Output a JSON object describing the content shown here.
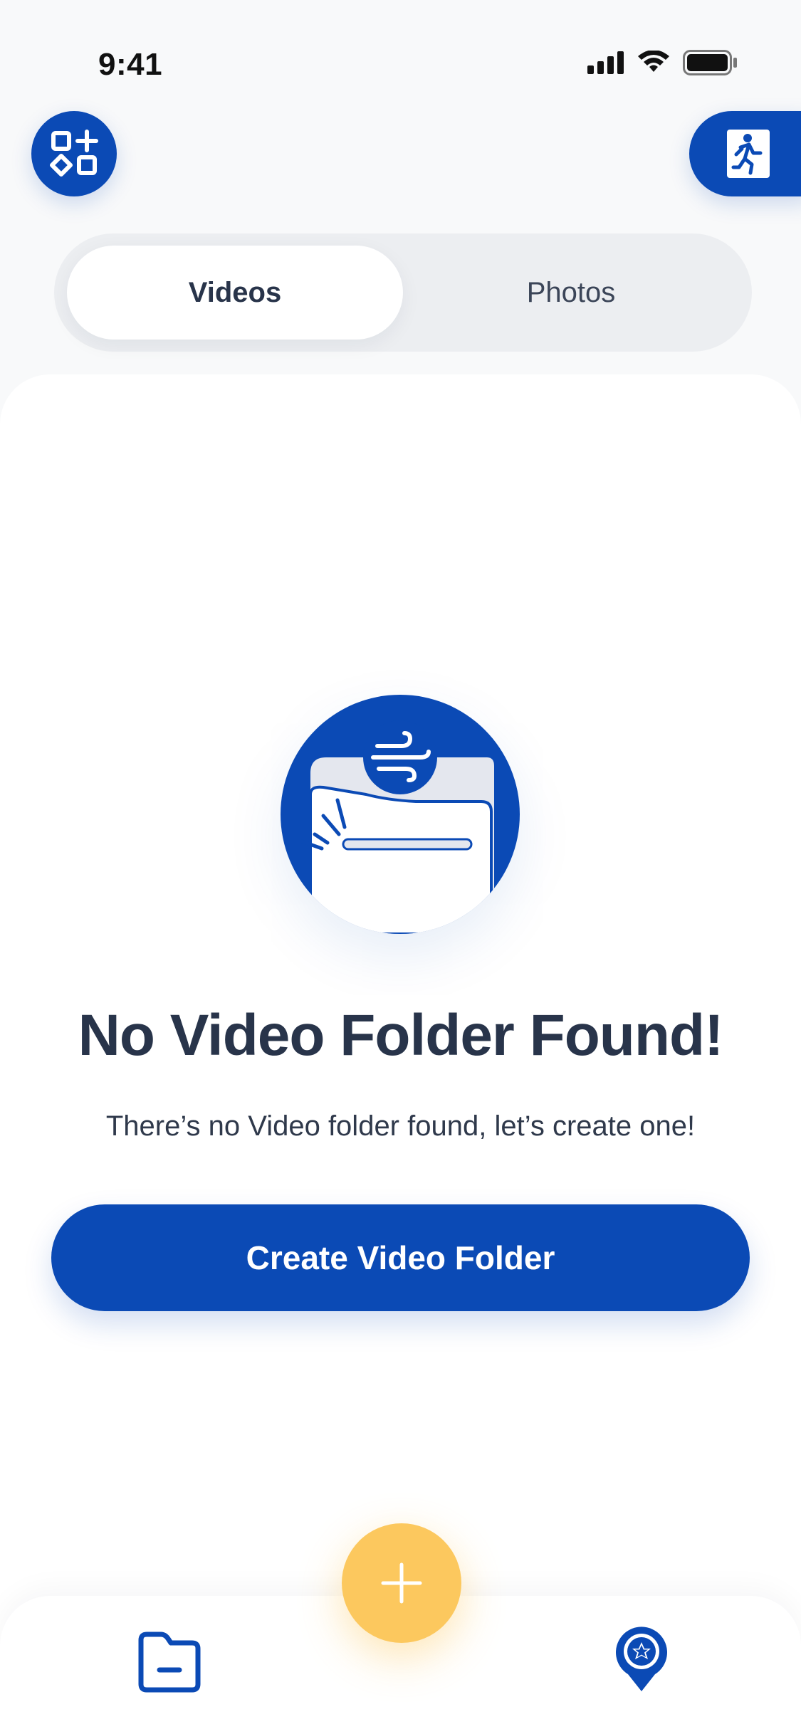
{
  "status_bar": {
    "time": "9:41"
  },
  "header": {
    "widgets_icon": "widgets-icon",
    "exit_icon": "exit-running-man-icon"
  },
  "tabs": [
    {
      "label": "Videos",
      "active": true
    },
    {
      "label": "Photos",
      "active": false
    }
  ],
  "empty_state": {
    "illustration": "empty-folder-wind-icon",
    "title": "No Video Folder Found!",
    "message": "There’s no Video folder found, let’s create one!",
    "button_label": "Create Video Folder"
  },
  "bottom_nav": {
    "left_icon": "folder-icon",
    "fab_icon": "plus-icon",
    "right_icon": "badge-location-icon"
  },
  "colors": {
    "primary": "#0b4ab5",
    "fab": "#fcc85e",
    "text_dark": "#28344a",
    "background": "#f8f9fa"
  }
}
